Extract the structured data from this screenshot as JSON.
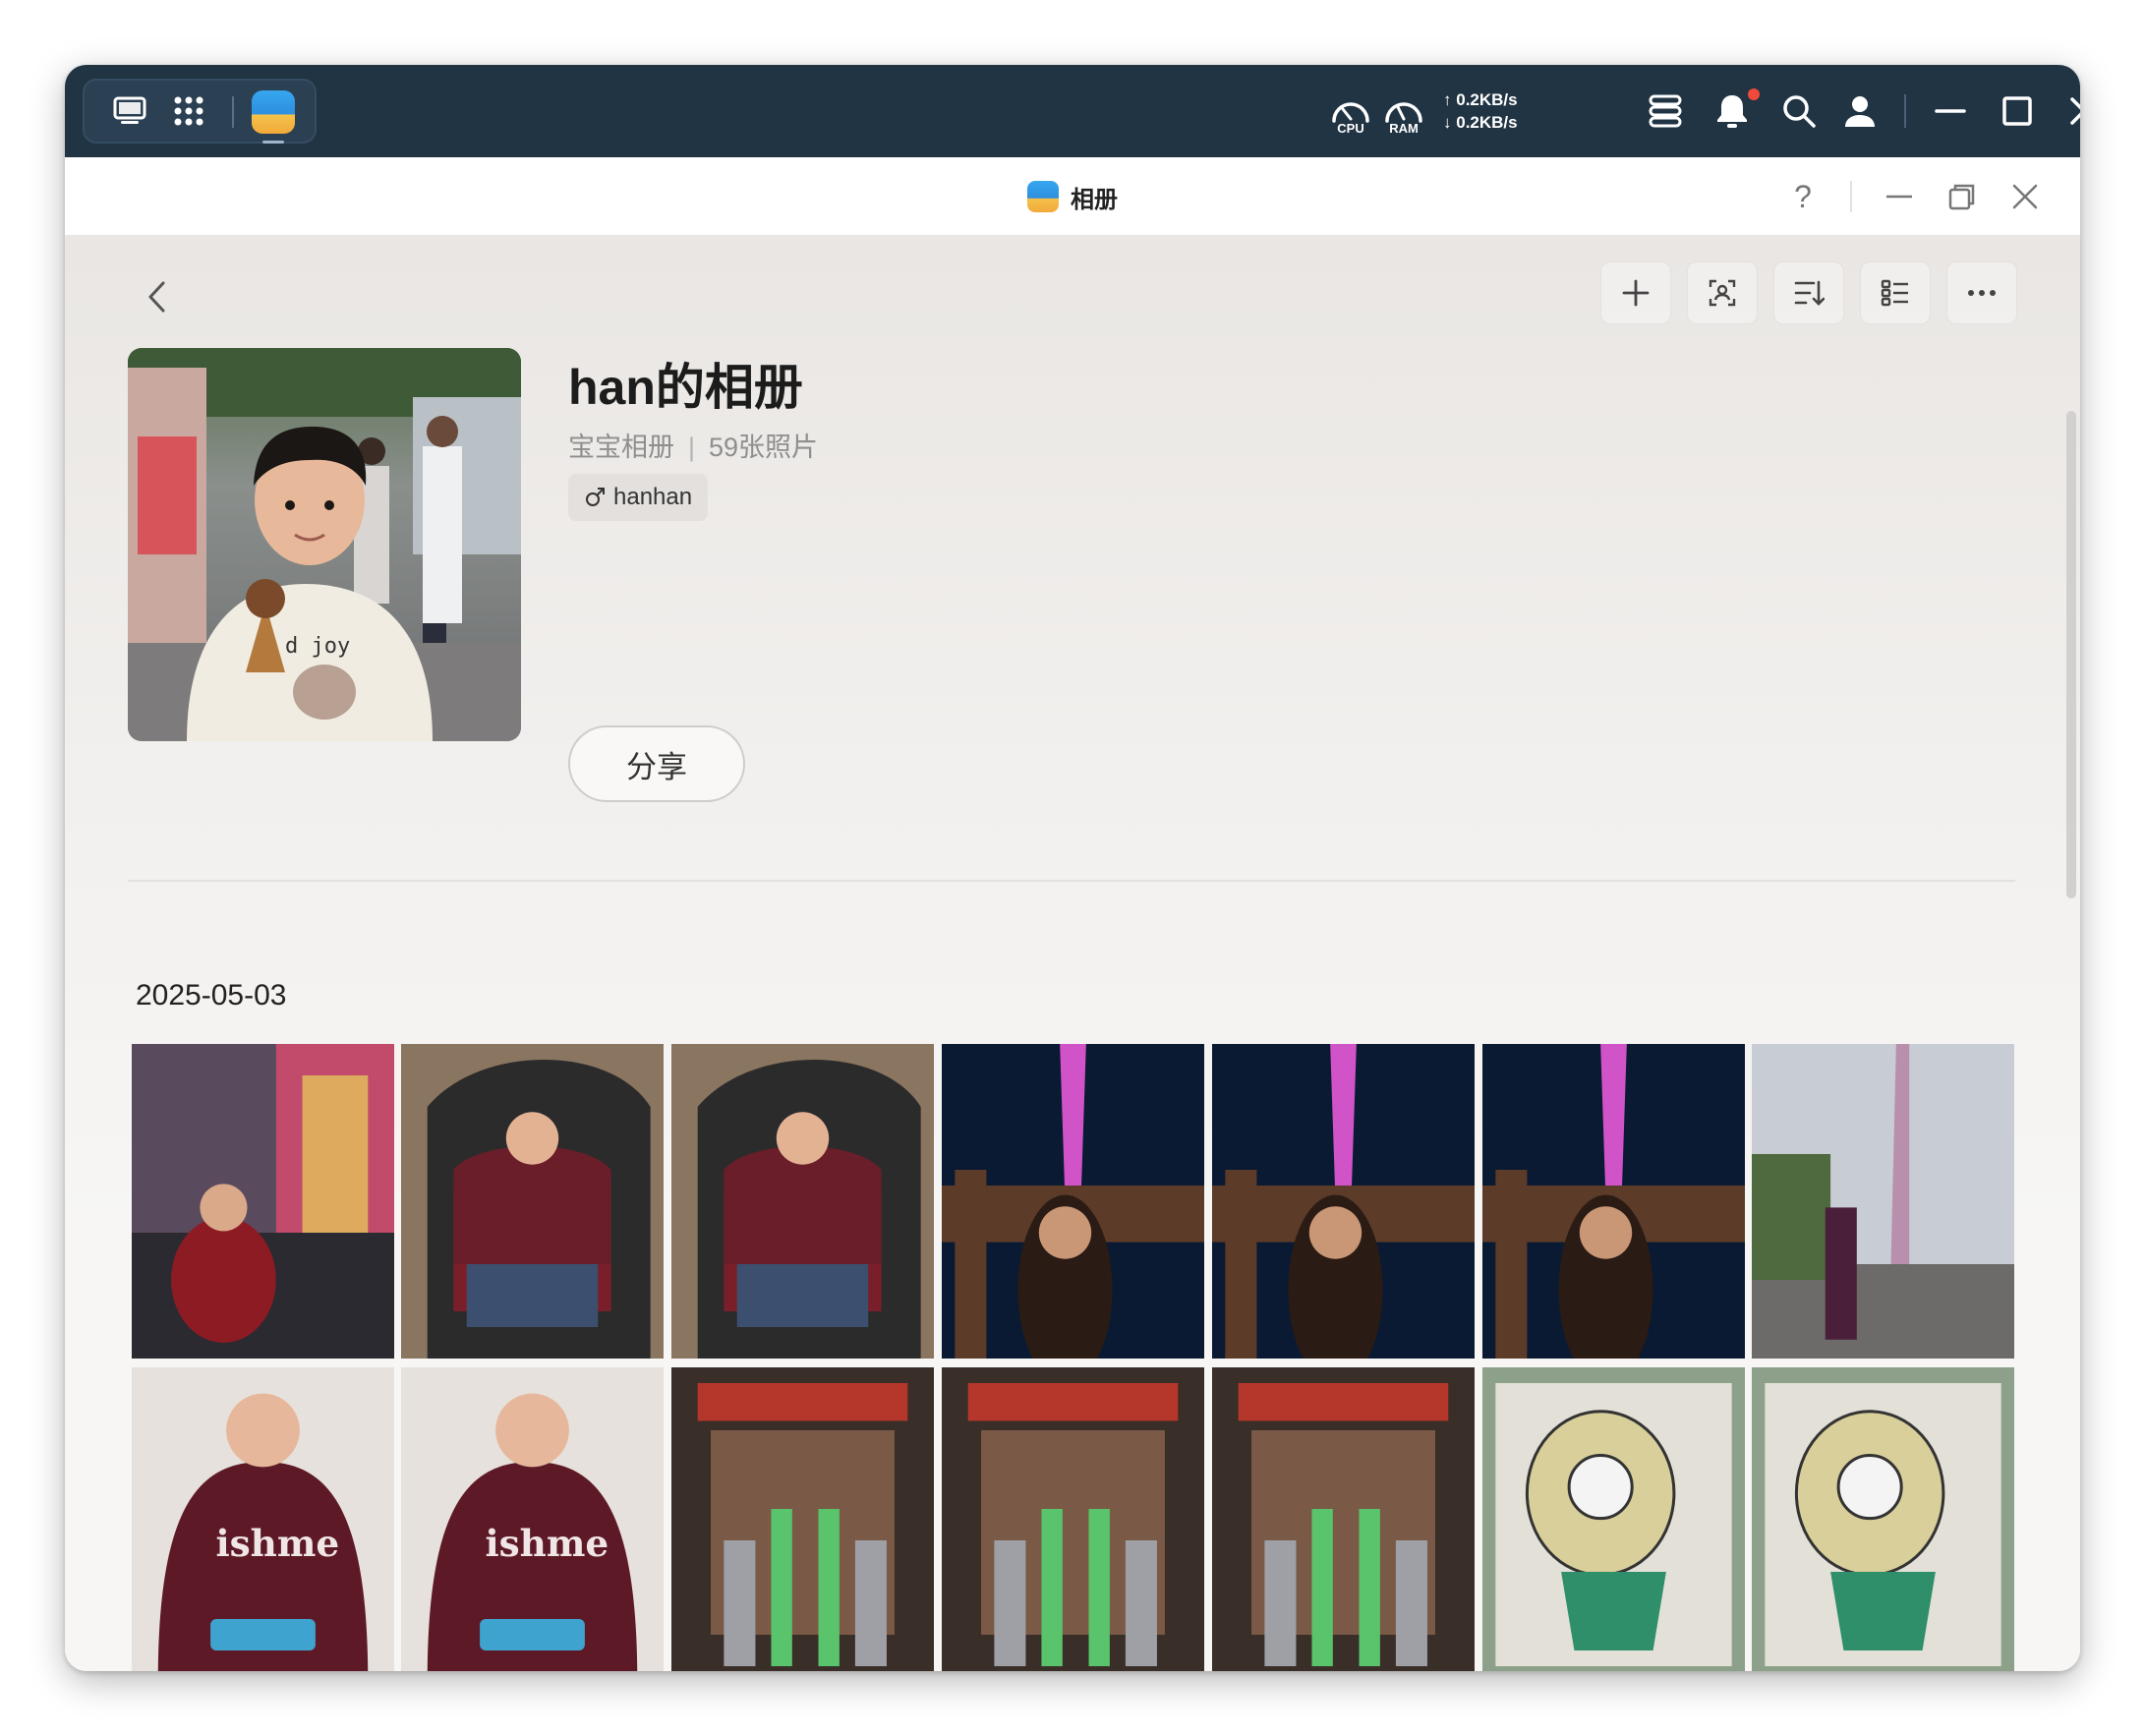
{
  "system_bar": {
    "cpu_label": "CPU",
    "ram_label": "RAM",
    "net_up": "0.2KB/s",
    "net_down": "0.2KB/s",
    "notification_badge_color": "#f04a3b"
  },
  "app": {
    "title": "相册",
    "help_label": "?"
  },
  "album": {
    "title": "han的相册",
    "category": "宝宝相册",
    "separator": "|",
    "count": "59张照片",
    "person_tag": "hanhan",
    "share_label": "分享"
  },
  "section": {
    "date": "2025-05-03"
  },
  "icons": {
    "toolbar": [
      "plus-icon",
      "face-scan-icon",
      "sort-icon",
      "list-view-icon",
      "more-icon"
    ]
  },
  "colors": {
    "system_bar_bg": "#213444",
    "content_bg": "#f2f0ee",
    "accent_blue": "#2d8fe0"
  }
}
